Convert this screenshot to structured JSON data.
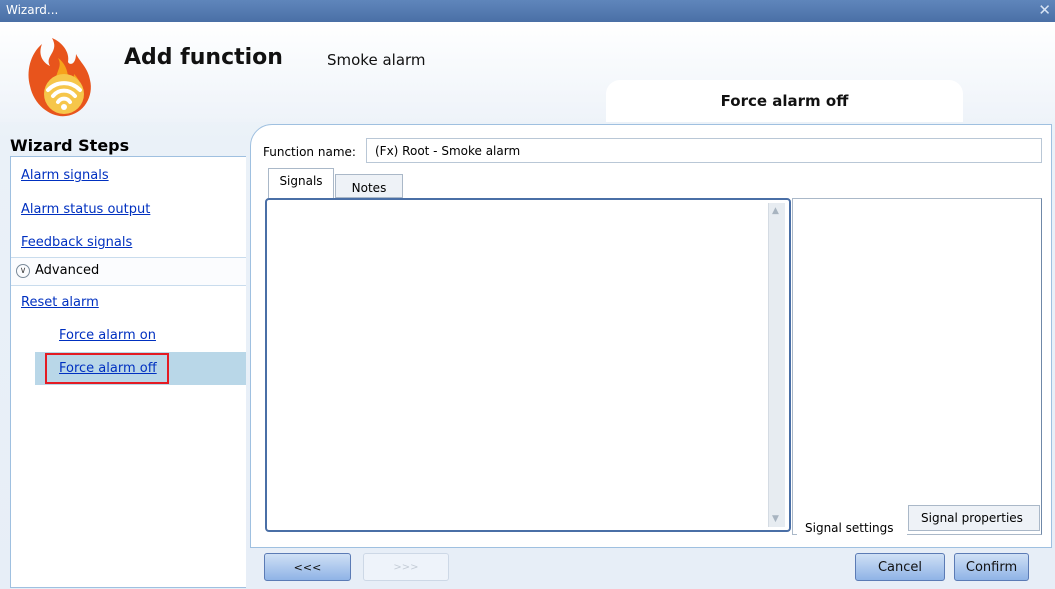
{
  "window": {
    "title": "Wizard...",
    "close_glyph": "✕"
  },
  "header": {
    "title": "Add function",
    "subtitle": "Smoke alarm",
    "logo_icon": "fire-wifi-icon",
    "current_step": "Force alarm off"
  },
  "wizard_steps": {
    "title": "Wizard Steps",
    "items": [
      "Alarm signals",
      "Alarm status output",
      "Feedback signals"
    ],
    "advanced_label": "Advanced",
    "advanced_items": [
      "Reset alarm",
      "Force alarm on",
      "Force alarm off"
    ],
    "selected": "Force alarm off"
  },
  "form": {
    "function_name_label": "Function name:",
    "function_name_value": "(Fx) Root - Smoke alarm"
  },
  "tabs": [
    "Signals",
    "Notes"
  ],
  "bottom_tabs": [
    "Signal settings",
    "Signal properties"
  ],
  "buttons": {
    "back": "<<<",
    "next": ">>>",
    "cancel": "Cancel",
    "confirm": "Confirm"
  },
  "colors": {
    "accent": "#4a6fa6",
    "link": "#0030c0",
    "highlight": "#e41b23",
    "selection": "#b9d7e8"
  }
}
